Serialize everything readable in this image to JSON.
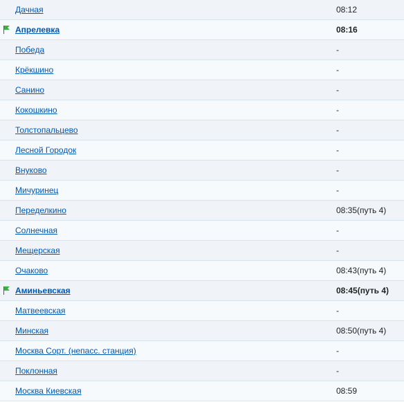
{
  "stations": [
    {
      "name": "Дачная",
      "time": "08:12",
      "flag": false,
      "bold": false
    },
    {
      "name": "Апрелевка",
      "time": "08:16",
      "flag": true,
      "bold": true
    },
    {
      "name": "Победа",
      "time": "-",
      "flag": false,
      "bold": false
    },
    {
      "name": "Крёкшино",
      "time": "-",
      "flag": false,
      "bold": false
    },
    {
      "name": "Санино",
      "time": "-",
      "flag": false,
      "bold": false
    },
    {
      "name": "Кокошкино",
      "time": "-",
      "flag": false,
      "bold": false
    },
    {
      "name": "Толстопальцево",
      "time": "-",
      "flag": false,
      "bold": false
    },
    {
      "name": "Лесной Городок",
      "time": "-",
      "flag": false,
      "bold": false
    },
    {
      "name": "Внуково",
      "time": "-",
      "flag": false,
      "bold": false
    },
    {
      "name": "Мичуринец",
      "time": "-",
      "flag": false,
      "bold": false
    },
    {
      "name": "Переделкино",
      "time": "08:35(путь 4)",
      "flag": false,
      "bold": false
    },
    {
      "name": "Солнечная",
      "time": "-",
      "flag": false,
      "bold": false
    },
    {
      "name": "Мещерская",
      "time": "-",
      "flag": false,
      "bold": false
    },
    {
      "name": "Очаково",
      "time": "08:43(путь 4)",
      "flag": false,
      "bold": false
    },
    {
      "name": "Аминьевская",
      "time": "08:45(путь 4)",
      "flag": true,
      "bold": true
    },
    {
      "name": "Матвеевская",
      "time": "-",
      "flag": false,
      "bold": false
    },
    {
      "name": "Минская",
      "time": "08:50(путь 4)",
      "flag": false,
      "bold": false
    },
    {
      "name": "Москва Сорт. (непасс. станция)",
      "time": "-",
      "flag": false,
      "bold": false
    },
    {
      "name": "Поклонная",
      "time": "-",
      "flag": false,
      "bold": false
    },
    {
      "name": "Москва Киевская",
      "time": "08:59",
      "flag": false,
      "bold": false
    }
  ]
}
